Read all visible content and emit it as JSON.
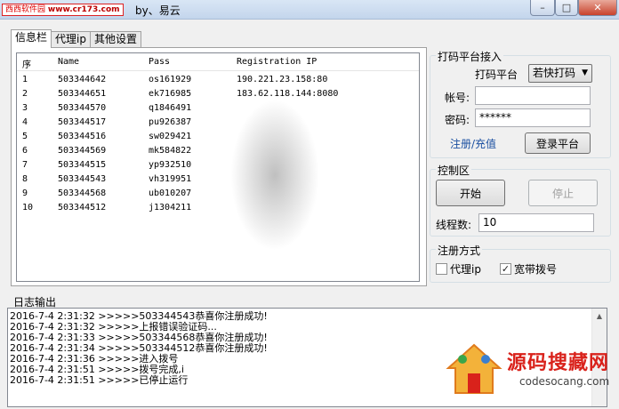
{
  "window": {
    "site_badge_text": "西西软件园",
    "site_badge_url": "www.cr173.com",
    "title": "by、易云",
    "min_glyph": "–",
    "max_glyph": "□",
    "close_glyph": "✕"
  },
  "tabs": [
    {
      "label": "信息栏",
      "active": true
    },
    {
      "label": "代理ip",
      "active": false
    },
    {
      "label": "其他设置",
      "active": false
    }
  ],
  "table": {
    "columns": [
      "序",
      "Name",
      "Pass",
      "Registration IP"
    ],
    "rows": [
      [
        "1",
        "503344642",
        "os161929",
        "190.221.23.158:80"
      ],
      [
        "2",
        "503344651",
        "ek716985",
        "183.62.118.144:8080"
      ],
      [
        "3",
        "503344570",
        "q1846491",
        ""
      ],
      [
        "4",
        "503344517",
        "pu926387",
        ""
      ],
      [
        "5",
        "503344516",
        "sw029421",
        ""
      ],
      [
        "6",
        "503344569",
        "mk584822",
        ""
      ],
      [
        "7",
        "503344515",
        "yp932510",
        ""
      ],
      [
        "8",
        "503344543",
        "vh319951",
        ""
      ],
      [
        "9",
        "503344568",
        "ub010207",
        ""
      ],
      [
        "10",
        "503344512",
        "j1304211",
        ""
      ]
    ]
  },
  "platform": {
    "group_title": "打码平台接入",
    "platform_label": "打码平台",
    "platform_value": "若快打码",
    "account_label": "帐号:",
    "account_value": "",
    "password_label": "密码:",
    "password_value": "******",
    "register_link": "注册/充值",
    "login_button": "登录平台"
  },
  "control": {
    "group_title": "控制区",
    "start_button": "开始",
    "stop_button": "停止",
    "threads_label": "线程数:",
    "threads_value": "10"
  },
  "register_mode": {
    "group_title": "注册方式",
    "proxy_label": "代理ip",
    "proxy_checked": false,
    "dialup_label": "宽带拨号",
    "dialup_checked": true
  },
  "log": {
    "title": "日志输出",
    "lines": [
      "2016-7-4 2:31:32 >>>>>503344543恭喜你注册成功!",
      "2016-7-4 2:31:32 >>>>>上报错误验证码...",
      "2016-7-4 2:31:33 >>>>>503344568恭喜你注册成功!",
      "2016-7-4 2:31:34 >>>>>503344512恭喜你注册成功!",
      "2016-7-4 2:31:36 >>>>>进入拨号",
      "2016-7-4 2:31:51 >>>>>拨号完成,i",
      "2016-7-4 2:31:51 >>>>>已停止运行"
    ]
  },
  "watermark": {
    "title": "源码搜藏网",
    "subtitle": "codesocang.com"
  }
}
